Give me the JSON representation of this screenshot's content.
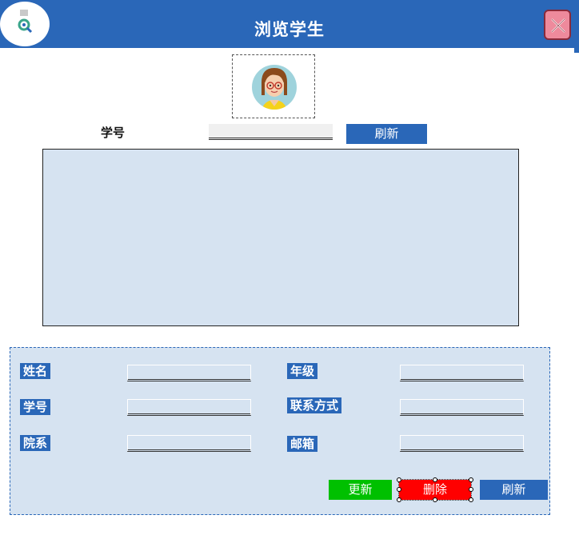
{
  "window": {
    "title": "浏览学生",
    "logo_icon": "search-user-icon",
    "close_icon": "close-icon",
    "accent_color": "#2a67b8"
  },
  "search": {
    "label": "学号",
    "value": "",
    "refresh_label": "刷新"
  },
  "avatar": {
    "icon": "student-avatar-icon"
  },
  "details": {
    "fields": {
      "name": {
        "label": "姓名",
        "value": ""
      },
      "grade": {
        "label": "年级",
        "value": ""
      },
      "student_id": {
        "label": "学号",
        "value": ""
      },
      "contact": {
        "label": "联系方式",
        "value": ""
      },
      "department": {
        "label": "院系",
        "value": ""
      },
      "email": {
        "label": "邮箱",
        "value": ""
      }
    },
    "buttons": {
      "update": "更新",
      "delete": "删除",
      "refresh": "刷新"
    }
  }
}
